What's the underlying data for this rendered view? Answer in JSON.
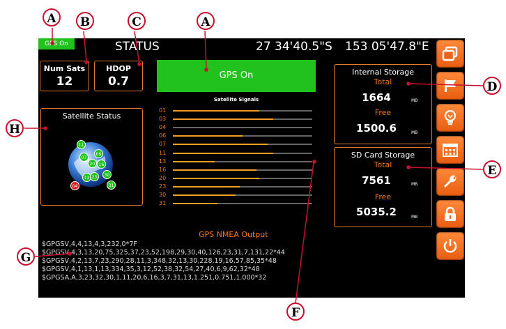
{
  "header": {
    "gps_badge": "GPS On",
    "title": "STATUS",
    "latitude": "27 34'40.5\"S",
    "longitude": "153 05'47.8\"E"
  },
  "num_sats": {
    "label": "Num Sats",
    "value": "12"
  },
  "hdop": {
    "label": "HDOP",
    "value": "0.7"
  },
  "gps_status": "GPS On",
  "satellite_status_title": "Satellite Status",
  "satellite_markers": [
    {
      "id": "11",
      "color": "#22c21e"
    },
    {
      "id": "06",
      "color": "#22c21e"
    },
    {
      "id": "07",
      "color": "#22c21e"
    },
    {
      "id": "20",
      "color": "#22c21e"
    },
    {
      "id": "16",
      "color": "#22c21e"
    },
    {
      "id": "30",
      "color": "#22c21e"
    },
    {
      "id": "13",
      "color": "#22c21e"
    },
    {
      "id": "23",
      "color": "#22c21e"
    },
    {
      "id": "31",
      "color": "#22c21e"
    },
    {
      "id": "04",
      "color": "#e51c1c"
    }
  ],
  "signals": {
    "title": "Satellite Signals",
    "rows": [
      {
        "id": "01",
        "level": 0.62
      },
      {
        "id": "03",
        "level": 0.72
      },
      {
        "id": "04",
        "level": 0.0
      },
      {
        "id": "06",
        "level": 0.5
      },
      {
        "id": "07",
        "level": 0.68
      },
      {
        "id": "11",
        "level": 0.72
      },
      {
        "id": "13",
        "level": 0.3
      },
      {
        "id": "16",
        "level": 0.6
      },
      {
        "id": "20",
        "level": 0.62
      },
      {
        "id": "23",
        "level": 0.48
      },
      {
        "id": "30",
        "level": 0.45
      },
      {
        "id": "31",
        "level": 0.32
      }
    ]
  },
  "internal_storage": {
    "title": "Internal Storage",
    "total_label": "Total",
    "total": "1664",
    "unit": "MB",
    "free_label": "Free",
    "free": "1500.6"
  },
  "sd_storage": {
    "title": "SD Card Storage",
    "total_label": "Total",
    "total": "7561",
    "unit": "MB",
    "free_label": "Free",
    "free": "5035.2"
  },
  "nmea": {
    "title": "GPS NMEA Output",
    "lines": [
      "$GPGSV,4,4,13,4,3,232,0*7F",
      "$GPGSV,4,3,13,20,75,325,37,23,52,198,29,30,40,126,23,31,7,131,22*44",
      "$GPGSV,4,2,13,7,23,290,28,11,3,348,32,13,30,228,19,16,57,85,35*48",
      "$GPGSV,4,1,13,1,13,334,35,3,12,52,38,32,54,27,40,6,9,62,32*48",
      "$GPGSA,A,3,23,32,30,1,11,20,6,16,3,7,31,13,1.251,0.751,1.000*32"
    ]
  },
  "sidebar_icons": [
    "windows-icon",
    "flag-icon",
    "lightbulb-icon",
    "calendar-icon",
    "wrench-icon",
    "lock-icon",
    "power-icon"
  ],
  "callouts": {
    "a1": "A",
    "b": "B",
    "c": "C",
    "a2": "A",
    "d": "D",
    "e": "E",
    "f": "F",
    "g": "G",
    "h": "H"
  }
}
